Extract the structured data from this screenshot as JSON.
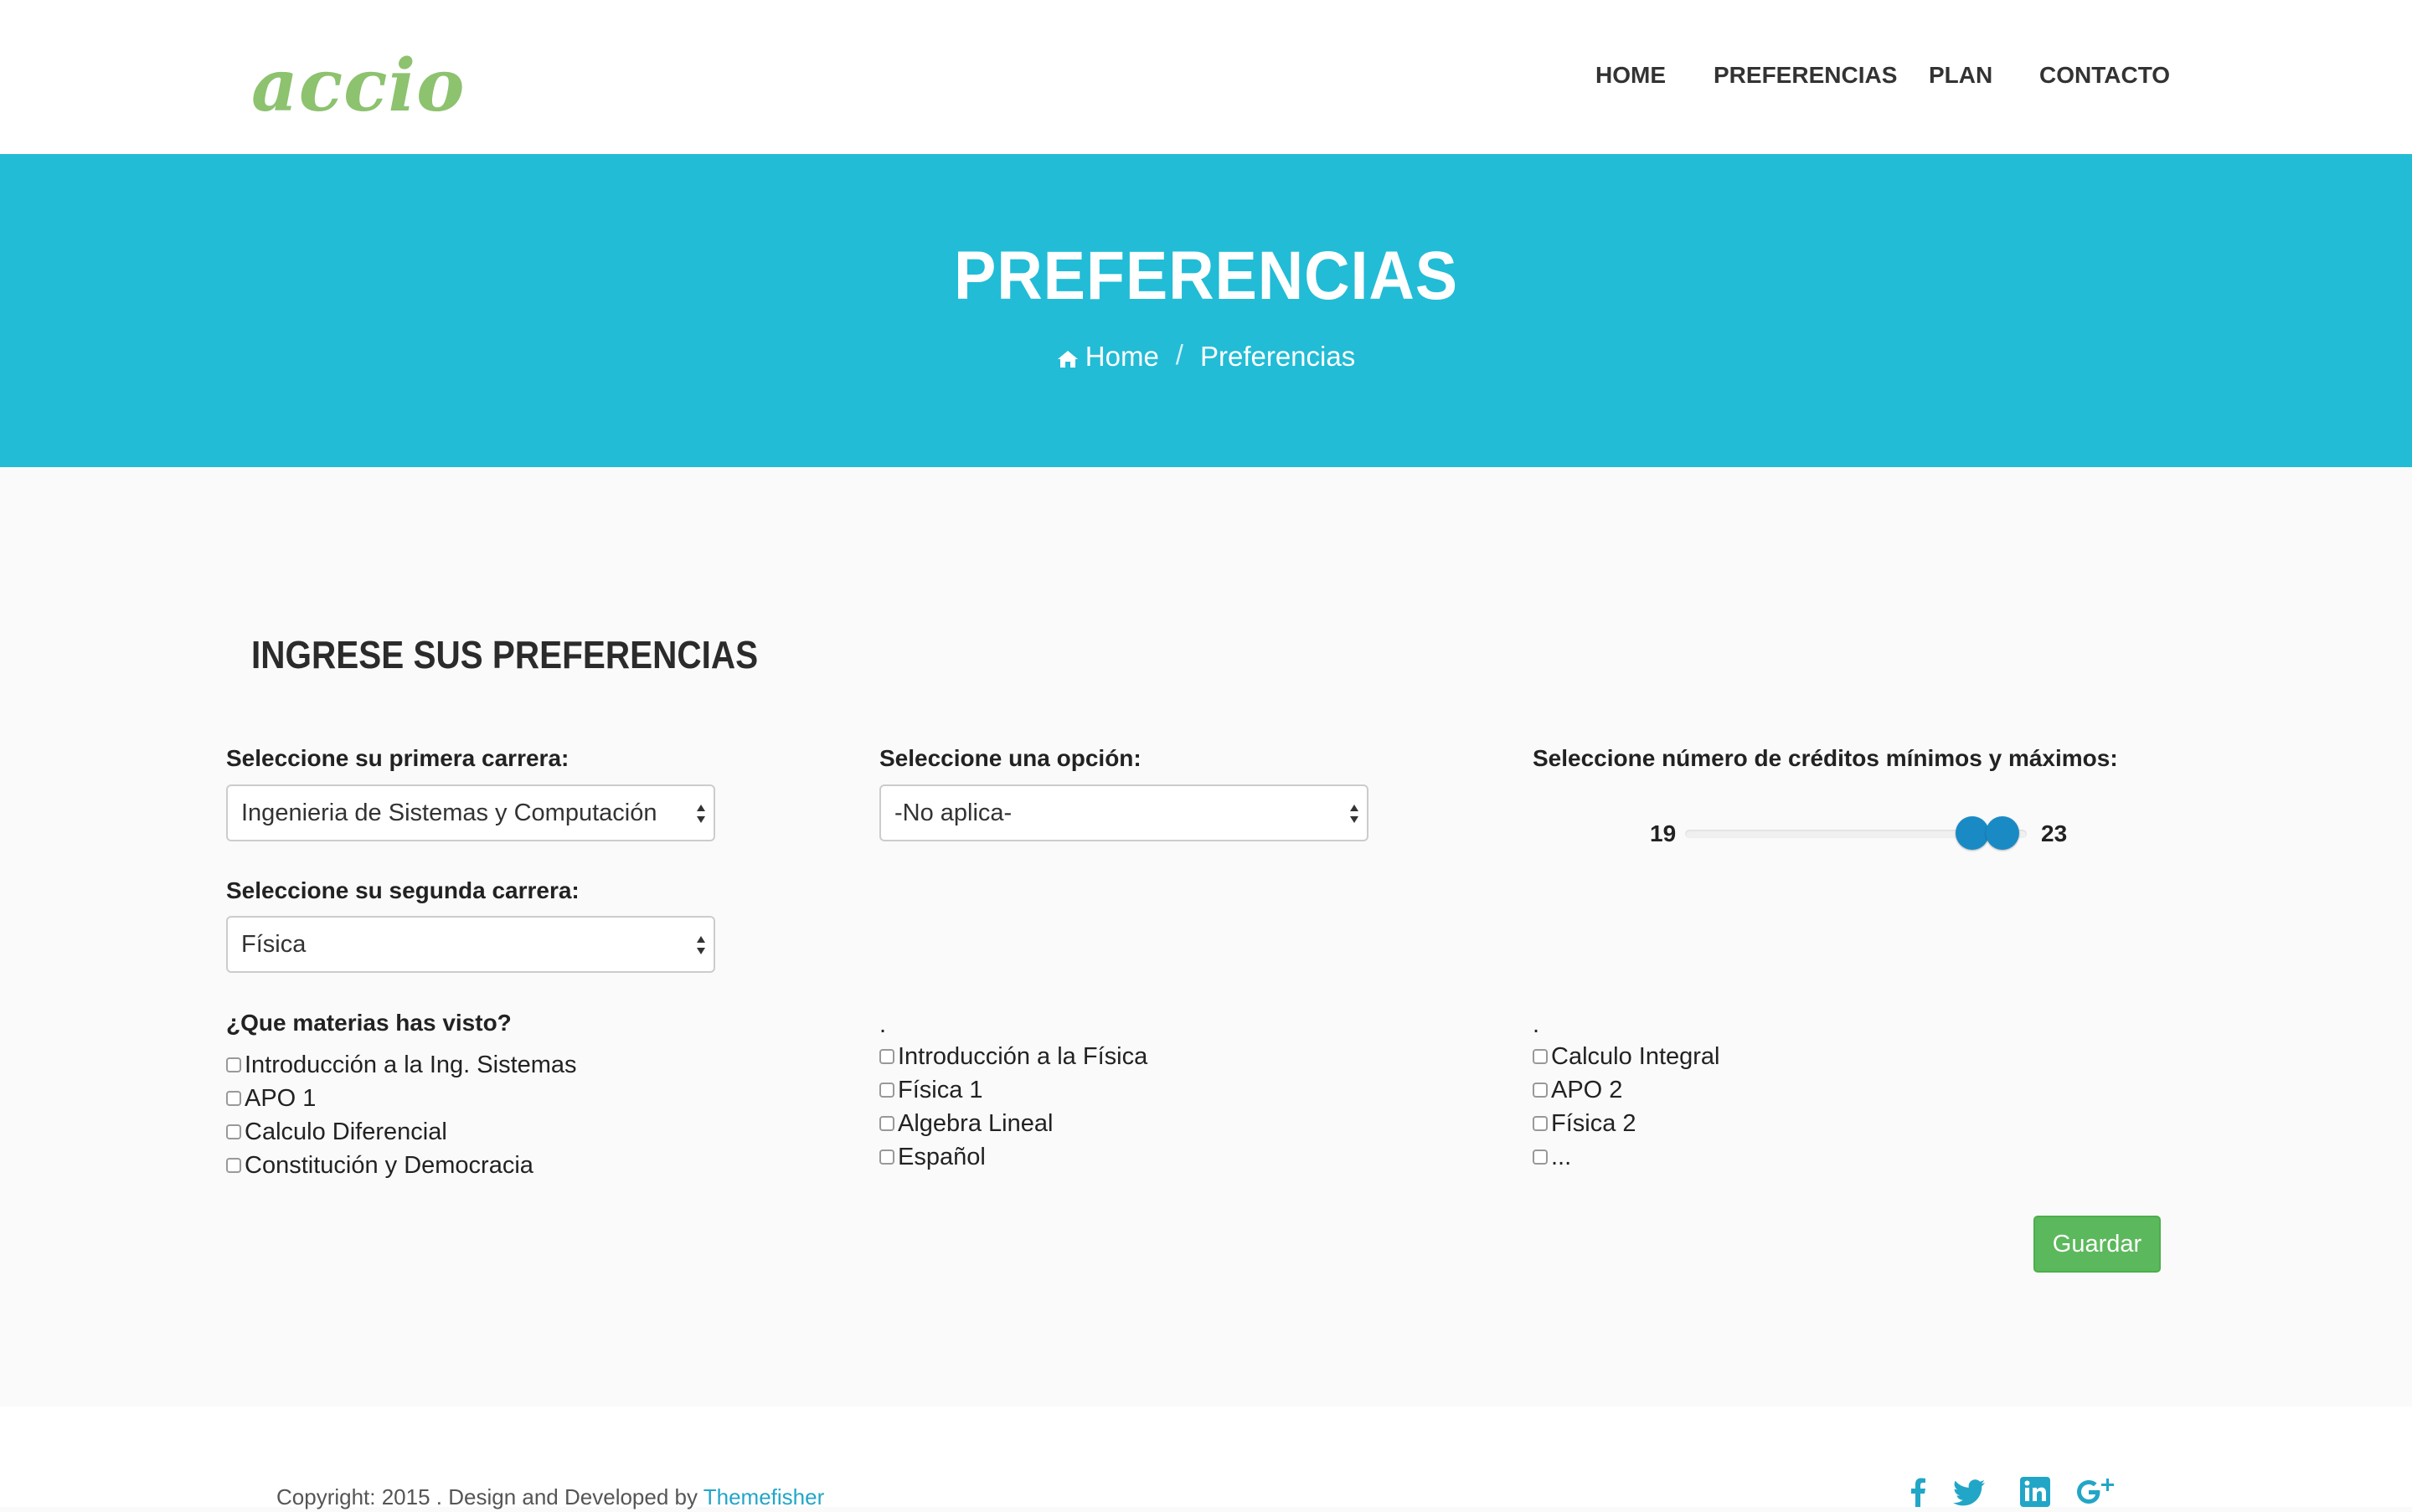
{
  "brand": {
    "logo_text": "accio",
    "logo_color": "#8dc26f"
  },
  "nav": {
    "items": [
      {
        "label": "HOME"
      },
      {
        "label": "PREFERENCIAS"
      },
      {
        "label": "PLAN"
      },
      {
        "label": "CONTACTO"
      }
    ]
  },
  "hero": {
    "title": "PREFERENCIAS",
    "breadcrumb": [
      {
        "label": "Home",
        "icon": "home-icon"
      },
      {
        "label": "Preferencias"
      }
    ],
    "separator": "/",
    "background": "#22bcd6"
  },
  "form": {
    "title": "INGRESE SUS PREFERENCIAS",
    "primary_career": {
      "label": "Seleccione su primera carrera:",
      "value": "Ingenieria de Sistemas y Computación"
    },
    "option": {
      "label": "Seleccione una opción:",
      "value": "-No aplica-"
    },
    "second_career": {
      "label": "Seleccione su segunda carrera:",
      "value": "Física"
    },
    "credits": {
      "label": "Seleccione número de créditos mínimos y máximos:",
      "min_label": "19",
      "max_label": "23",
      "low_fraction": 0.84,
      "high_fraction": 0.93
    },
    "subjects": {
      "label": "¿Que materias has visto?",
      "column_marker": ".",
      "col1": [
        "Introducción a la Ing. Sistemas",
        "APO 1",
        "Calculo Diferencial",
        "Constitución y Democracia"
      ],
      "col2": [
        "Introducción a la Física",
        "Física 1",
        "Algebra Lineal",
        "Español"
      ],
      "col3": [
        "Calculo Integral",
        "APO 2",
        "Física 2",
        "..."
      ]
    },
    "save_label": "Guardar",
    "save_color": "#5cb85c"
  },
  "footer": {
    "copyright_prefix": "Copyright: 2015 . Design and Developed by ",
    "copyright_link": "Themefisher",
    "social": [
      "facebook-icon",
      "twitter-icon",
      "linkedin-icon",
      "google-plus-icon"
    ],
    "social_color": "#22a6c7"
  }
}
